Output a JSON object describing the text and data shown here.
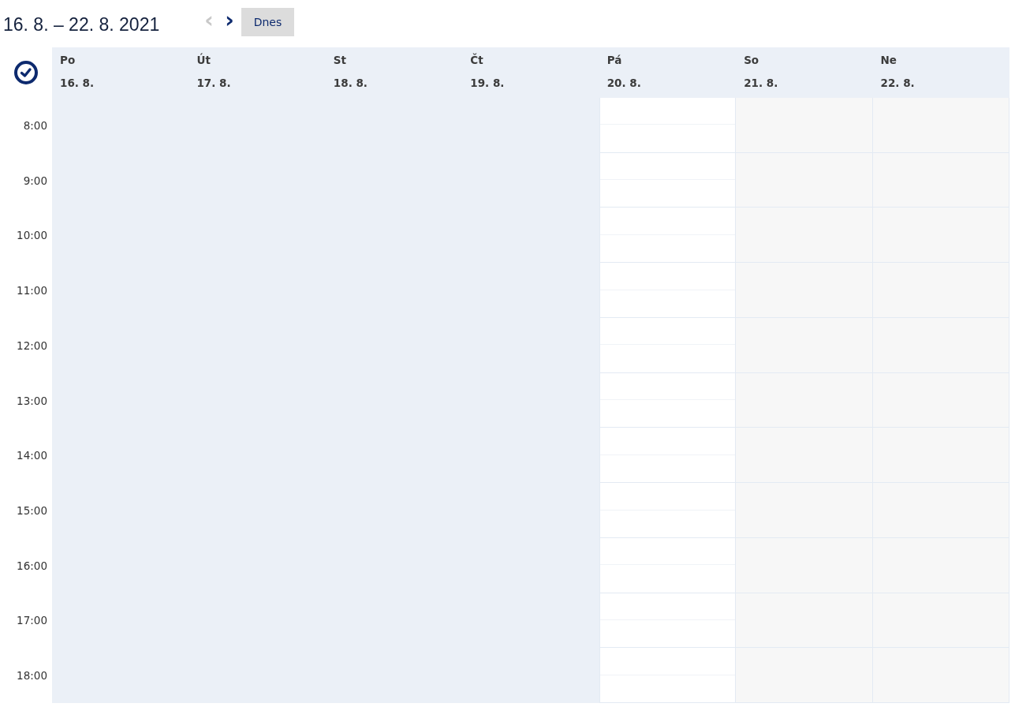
{
  "toolbar": {
    "range_title": "16. 8. – 22. 8. 2021",
    "prev_button": {
      "label": "‹",
      "disabled": true
    },
    "next_button": {
      "label": "›",
      "disabled": false
    },
    "today_button": "Dnes"
  },
  "days": [
    {
      "weekday": "Po",
      "date": "16. 8.",
      "kind": "past"
    },
    {
      "weekday": "Út",
      "date": "17. 8.",
      "kind": "past"
    },
    {
      "weekday": "St",
      "date": "18. 8.",
      "kind": "past"
    },
    {
      "weekday": "Čt",
      "date": "19. 8.",
      "kind": "past"
    },
    {
      "weekday": "Pá",
      "date": "20. 8.",
      "kind": "open"
    },
    {
      "weekday": "So",
      "date": "21. 8.",
      "kind": "weekend"
    },
    {
      "weekday": "Ne",
      "date": "22. 8.",
      "kind": "weekend"
    }
  ],
  "hours": [
    "8:00",
    "9:00",
    "10:00",
    "11:00",
    "12:00",
    "13:00",
    "14:00",
    "15:00",
    "16:00",
    "17:00",
    "18:00"
  ]
}
